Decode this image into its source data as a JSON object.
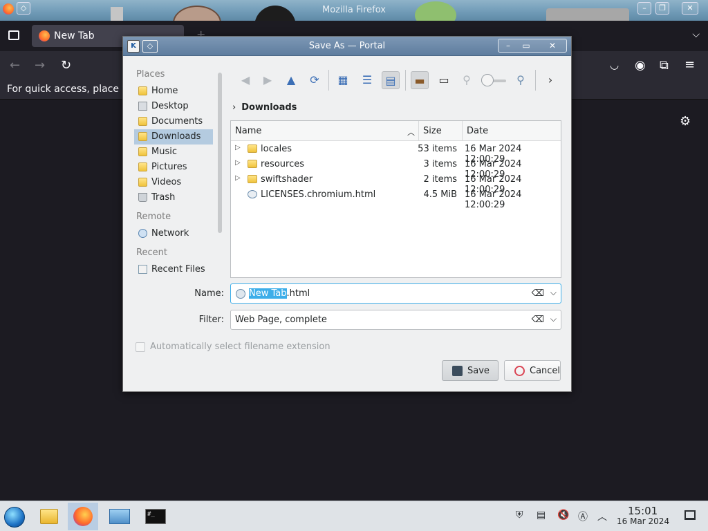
{
  "firefox": {
    "window_title": "Mozilla Firefox",
    "tab_label": "New Tab",
    "new_tab_icon": "plus-icon",
    "hint_text": "For quick access, place y"
  },
  "dialog": {
    "title": "Save As — Portal",
    "app_icon_letter": "K",
    "places": {
      "head_places": "Places",
      "head_remote": "Remote",
      "head_recent": "Recent",
      "items": [
        {
          "label": "Home",
          "icon": "folder-icon"
        },
        {
          "label": "Desktop",
          "icon": "desktop-icon"
        },
        {
          "label": "Documents",
          "icon": "folder-icon"
        },
        {
          "label": "Downloads",
          "icon": "folder-icon",
          "selected": true
        },
        {
          "label": "Music",
          "icon": "folder-icon"
        },
        {
          "label": "Pictures",
          "icon": "folder-icon"
        },
        {
          "label": "Videos",
          "icon": "folder-icon"
        },
        {
          "label": "Trash",
          "icon": "trash-icon"
        },
        {
          "label": "Network",
          "icon": "network-icon"
        },
        {
          "label": "Recent Files",
          "icon": "recent-files-icon"
        }
      ]
    },
    "breadcrumb": "Downloads",
    "columns": {
      "name": "Name",
      "size": "Size",
      "date": "Date"
    },
    "files": [
      {
        "name": "locales",
        "size": "53 items",
        "date": "16 Mar 2024 12:00:29",
        "type": "folder"
      },
      {
        "name": "resources",
        "size": "3 items",
        "date": "16 Mar 2024 12:00:29",
        "type": "folder"
      },
      {
        "name": "swiftshader",
        "size": "2 items",
        "date": "16 Mar 2024 12:00:29",
        "type": "folder"
      },
      {
        "name": "LICENSES.chromium.html",
        "size": "4.5 MiB",
        "date": "16 Mar 2024 12:00:29",
        "type": "html"
      }
    ],
    "name_label": "Name:",
    "name_selected": "New Tab",
    "name_rest": ".html",
    "filter_label": "Filter:",
    "filter_value": "Web Page, complete",
    "auto_ext_label": "Automatically select filename extension",
    "save_label": "Save",
    "cancel_label": "Cancel"
  },
  "taskbar": {
    "time": "15:01",
    "date": "16 Mar 2024",
    "terminal_text": "#_"
  },
  "colors": {
    "accent": "#3daee9",
    "selection": "#b4cbe0",
    "dialog_bg": "#eff0f1",
    "firefox_dark": "#1c1b22"
  }
}
